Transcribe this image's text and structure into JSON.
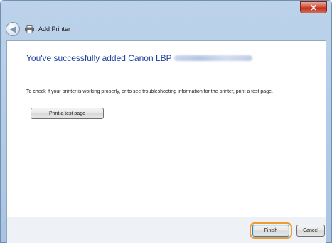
{
  "window": {
    "title": "Add Printer",
    "close_symbol": "✕"
  },
  "nav": {
    "back_symbol": "◀",
    "title": "Add Printer",
    "back_icon": "back-arrow-icon",
    "printer_icon": "printer-icon"
  },
  "main": {
    "heading": "You've successfully added Canon LBP",
    "info_text": "To check if your printer is working properly, or to see troubleshooting information for the printer, print a test page.",
    "test_page_button": "Print a test page"
  },
  "footer": {
    "finish_label": "Finish",
    "cancel_label": "Cancel"
  },
  "colors": {
    "heading": "#1e3fa0",
    "highlight": "#f39a2b",
    "close": "#c23219"
  }
}
